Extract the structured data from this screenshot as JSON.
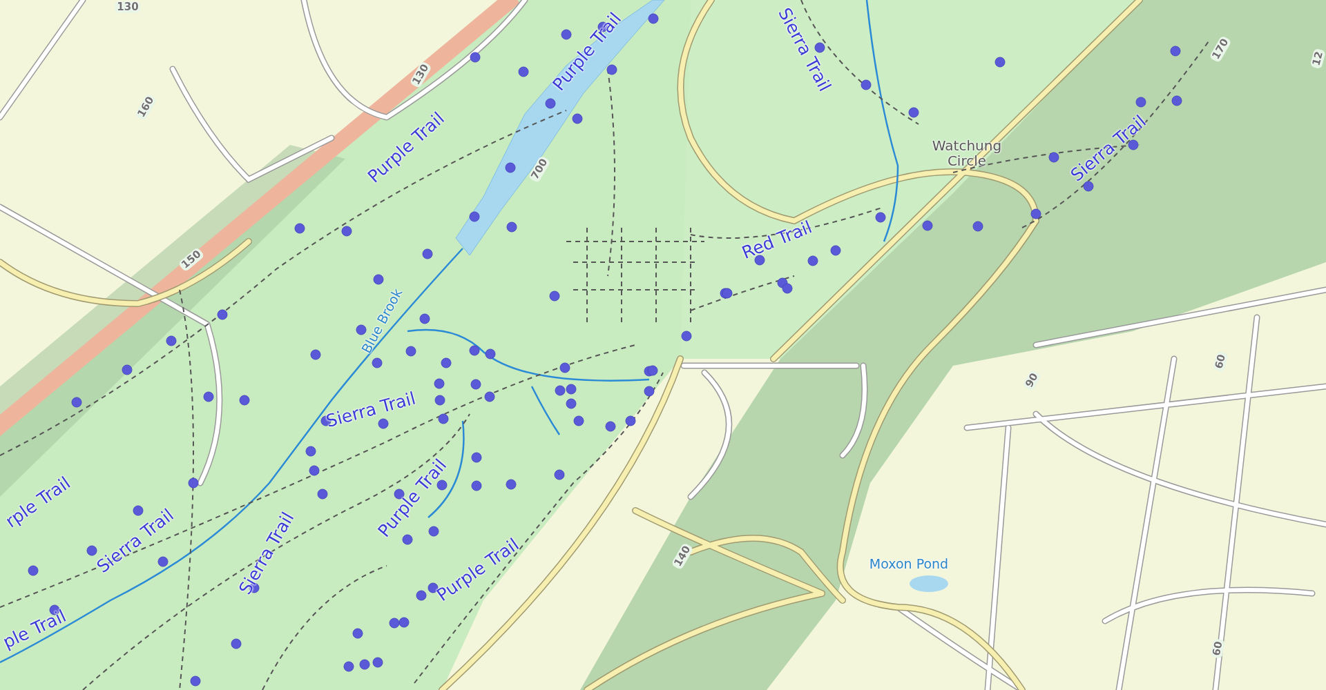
{
  "map": {
    "labels": [
      {
        "text": "130",
        "kind": "road_number"
      },
      {
        "text": "160",
        "kind": "road_number"
      },
      {
        "text": "130",
        "kind": "road_number"
      },
      {
        "text": "150",
        "kind": "road_number"
      },
      {
        "text": "Purple Trail",
        "kind": "trail"
      },
      {
        "text": "Purple Trail",
        "kind": "trail"
      },
      {
        "text": "700",
        "kind": "road_number"
      },
      {
        "text": "Blue Brook",
        "kind": "water"
      },
      {
        "text": "Sierra Trail",
        "kind": "trail"
      },
      {
        "text": "Watchung Circle",
        "kind": "place"
      },
      {
        "text": "Sierra Trail",
        "kind": "trail"
      },
      {
        "text": "170",
        "kind": "road_number"
      },
      {
        "text": "Red Trail",
        "kind": "trail"
      },
      {
        "text": "Sierra Trail",
        "kind": "trail"
      },
      {
        "text": "Purple Trail",
        "kind": "trail"
      },
      {
        "text": "rple Trail",
        "kind": "trail"
      },
      {
        "text": "Sierra Trail",
        "kind": "trail"
      },
      {
        "text": "Sierra Trail",
        "kind": "trail"
      },
      {
        "text": "Purple Trail",
        "kind": "trail"
      },
      {
        "text": "ple Trail",
        "kind": "trail"
      },
      {
        "text": "140",
        "kind": "road_number"
      },
      {
        "text": "90",
        "kind": "road_number"
      },
      {
        "text": "60",
        "kind": "road_number"
      },
      {
        "text": "60",
        "kind": "road_number"
      },
      {
        "text": "Moxon Pond",
        "kind": "water"
      },
      {
        "text": "12",
        "kind": "road_number"
      }
    ]
  }
}
